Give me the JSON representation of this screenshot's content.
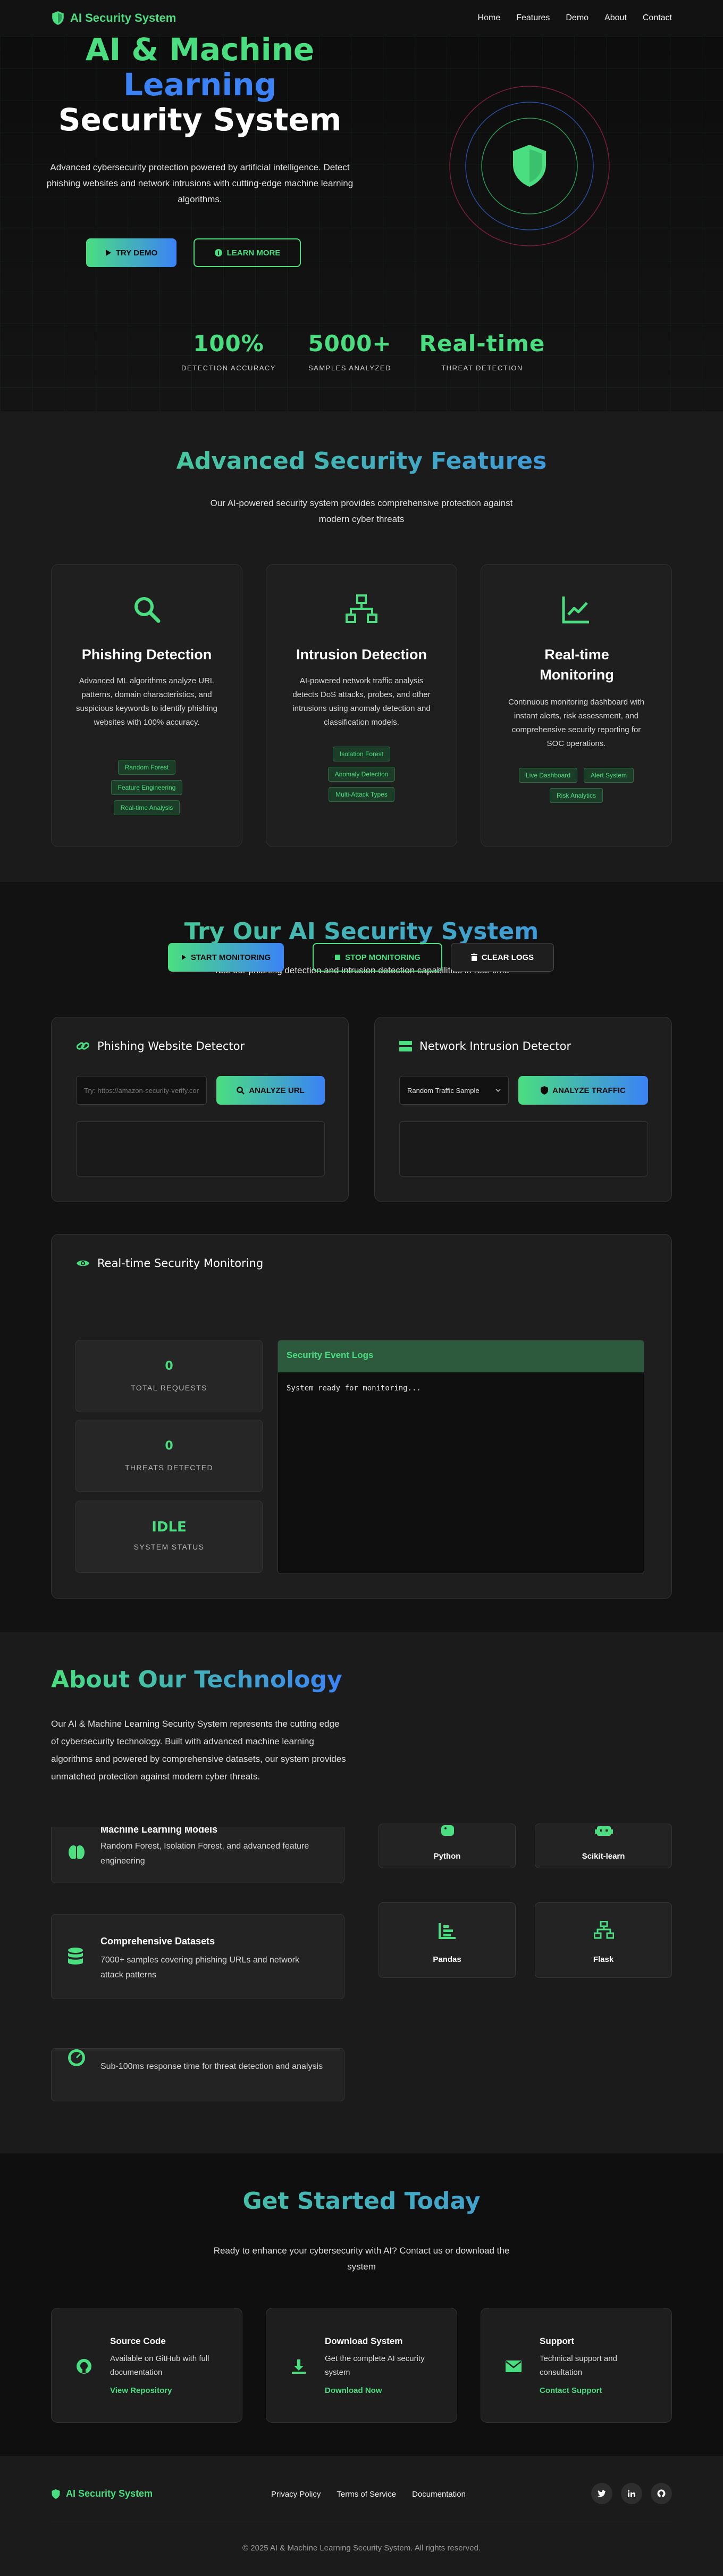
{
  "nav": {
    "brand": "AI Security System",
    "links": [
      "Home",
      "Features",
      "Demo",
      "About",
      "Contact"
    ]
  },
  "hero": {
    "title_line1": "AI & Machine",
    "title_line2": "Learning",
    "title_line3": "Security System",
    "subtitle": "Advanced cybersecurity protection powered by artificial intelligence. Detect phishing websites and network intrusions with cutting-edge machine learning algorithms.",
    "try_button": "TRY DEMO",
    "learn_button": "LEARN MORE",
    "stats": [
      {
        "value": "100%",
        "label": "DETECTION ACCURACY"
      },
      {
        "value": "5000+",
        "label": "SAMPLES ANALYZED"
      },
      {
        "value": "Real-time",
        "label": "THREAT DETECTION"
      }
    ]
  },
  "features": {
    "title": "Advanced Security Features",
    "subtitle": "Our AI-powered security system provides comprehensive protection against modern cyber threats",
    "cards": [
      {
        "icon": "search-icon",
        "title": "Phishing Detection",
        "text": "Advanced ML algorithms analyze URL patterns, domain characteristics, and suspicious keywords to identify phishing websites with 100% accuracy.",
        "tags": [
          "Random Forest",
          "Feature Engineering",
          "Real-time Analysis"
        ]
      },
      {
        "icon": "network-icon",
        "title": "Intrusion Detection",
        "text": "AI-powered network traffic analysis detects DoS attacks, probes, and other intrusions using anomaly detection and classification models.",
        "tags": [
          "Isolation Forest",
          "Anomaly Detection",
          "Multi-Attack Types"
        ]
      },
      {
        "icon": "chart-line-icon",
        "title": "Real-time Monitoring",
        "text": "Continuous monitoring dashboard with instant alerts, risk assessment, and comprehensive security reporting for SOC operations.",
        "tags": [
          "Live Dashboard",
          "Alert System",
          "Risk Analytics"
        ]
      }
    ]
  },
  "demo": {
    "title": "Try Our AI Security System",
    "subtitle": "Test our phishing detection and intrusion detection capabilities in real-time",
    "phishing": {
      "title": "Phishing Website Detector",
      "placeholder": "Try: https://amazon-security-verify.com",
      "button": "ANALYZE URL"
    },
    "intrusion": {
      "title": "Network Intrusion Detector",
      "select_value": "Random Traffic Sample",
      "button": "ANALYZE TRAFFIC"
    },
    "monitoring": {
      "title": "Real-time Security Monitoring",
      "start": "START MONITORING",
      "stop": "STOP MONITORING",
      "clear": "CLEAR LOGS",
      "metrics": [
        {
          "value": "0",
          "label": "TOTAL REQUESTS"
        },
        {
          "value": "0",
          "label": "THREATS DETECTED"
        },
        {
          "value": "IDLE",
          "label": "SYSTEM STATUS"
        }
      ],
      "logs_title": "Security Event Logs",
      "logs_text": "System ready for monitoring..."
    }
  },
  "about": {
    "title": "About Our Technology",
    "text": "Our AI & Machine Learning Security System represents the cutting edge of cybersecurity technology. Built with advanced machine learning algorithms and powered by comprehensive datasets, our system provides unmatched protection against modern cyber threats.",
    "cards": [
      {
        "icon": "brain-icon",
        "title": "Machine Learning Models",
        "text": "Random Forest, Isolation Forest, and advanced feature engineering"
      },
      {
        "icon": "database-icon",
        "title": "Comprehensive Datasets",
        "text": "7000+ samples covering phishing URLs and network attack patterns"
      },
      {
        "icon": "gauge-icon",
        "title": "",
        "text": "Sub-100ms response time for threat detection and analysis"
      }
    ],
    "tech": [
      {
        "icon": "python-icon",
        "label": "Python"
      },
      {
        "icon": "robot-icon",
        "label": "Scikit-learn"
      },
      {
        "icon": "table-icon",
        "label": "Pandas"
      },
      {
        "icon": "sitemap-icon",
        "label": "Flask"
      }
    ]
  },
  "started": {
    "title": "Get Started Today",
    "subtitle": "Ready to enhance your cybersecurity with AI? Contact us or download the system",
    "cards": [
      {
        "icon": "github-icon",
        "title": "Source Code",
        "text": "Available on GitHub with full documentation",
        "link": "View Repository"
      },
      {
        "icon": "download-icon",
        "title": "Download System",
        "text": "Get the complete AI security system",
        "link": "Download Now"
      },
      {
        "icon": "envelope-icon",
        "title": "Support",
        "text": "Technical support and consultation",
        "link": "Contact Support"
      }
    ]
  },
  "footer": {
    "brand": "AI Security System",
    "links": [
      "Privacy Policy",
      "Terms of Service",
      "Documentation"
    ],
    "social": [
      "twitter-icon",
      "linkedin-icon",
      "github-icon"
    ],
    "copyright": "© 2025 AI & Machine Learning Security System. All rights reserved."
  },
  "colors": {
    "accent_green": "#4ade80",
    "accent_blue": "#3b82f6",
    "background": "#121212"
  }
}
